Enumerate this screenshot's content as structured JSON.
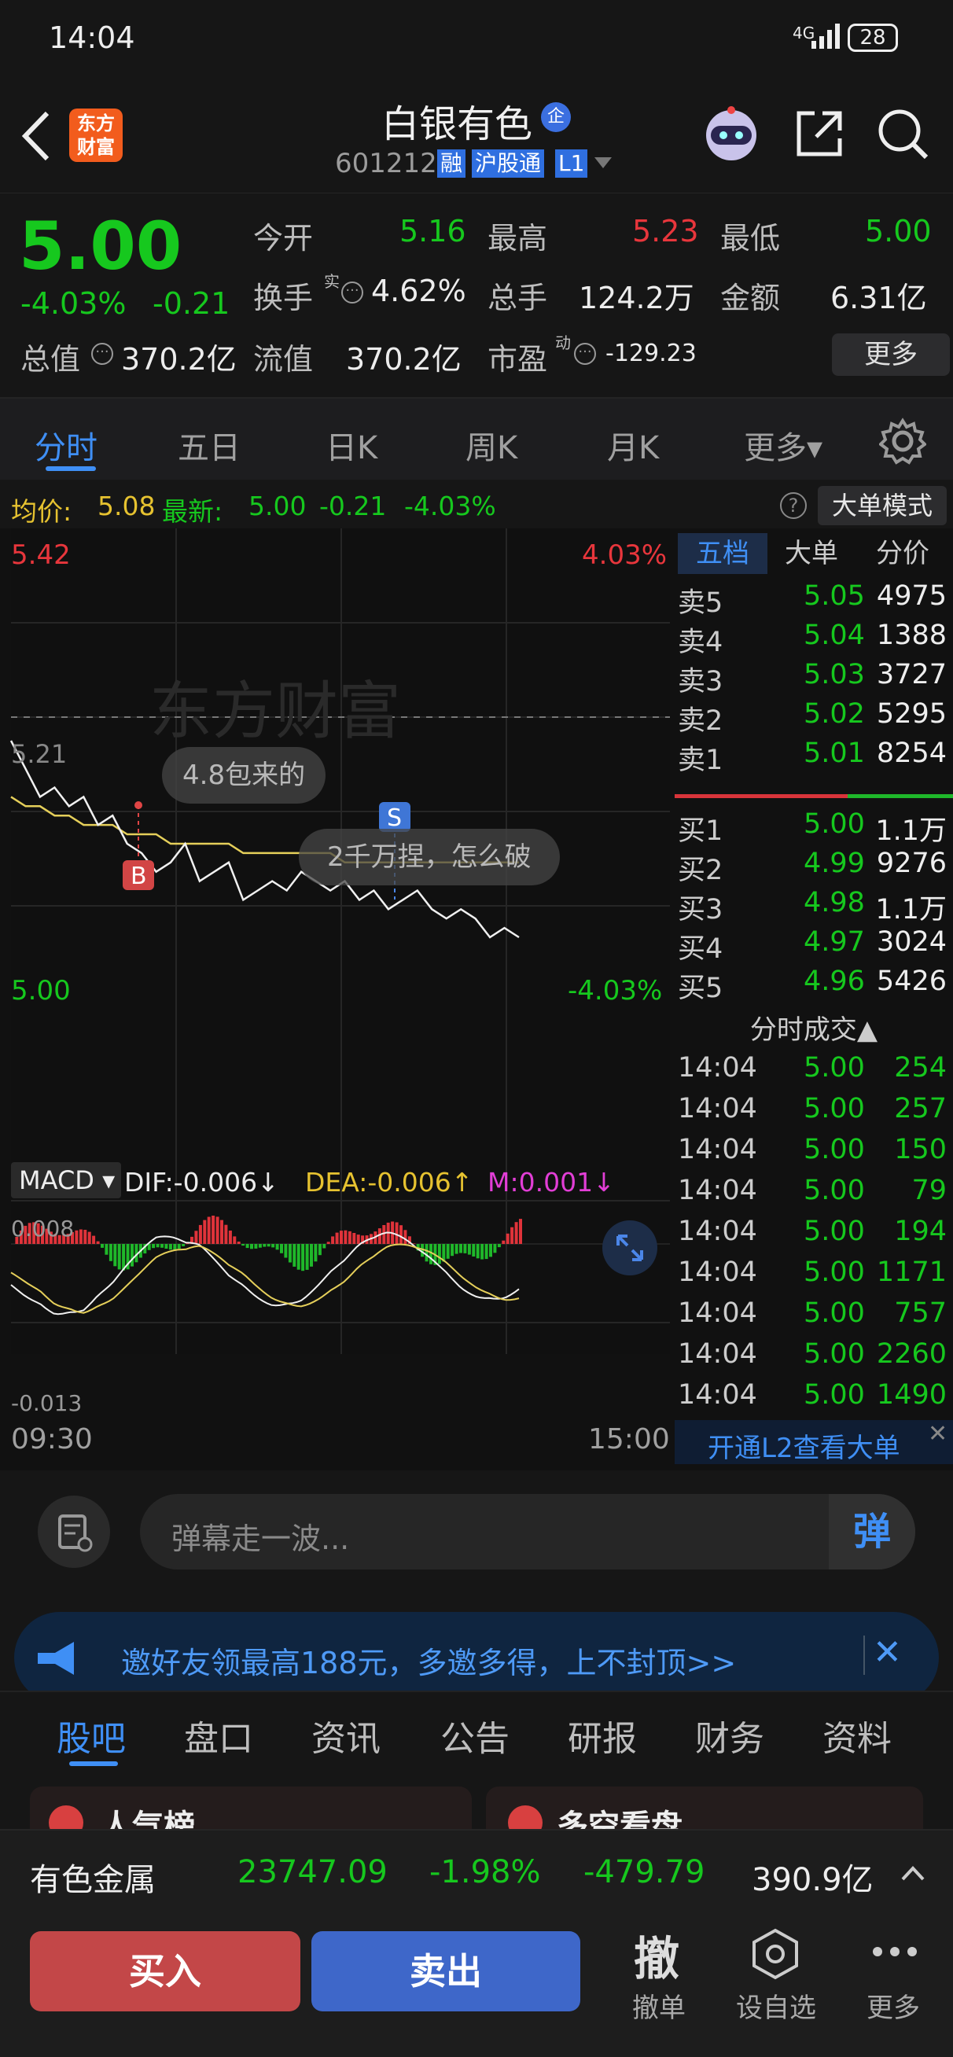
{
  "status": {
    "time": "14:04",
    "network": "4G",
    "battery": "28"
  },
  "header": {
    "logo_line1": "东方",
    "logo_line2": "财富",
    "name": "白银有色",
    "enterprise_badge": "企",
    "code": "601212",
    "tag_rong": "融",
    "tag_hgt": "沪股通",
    "tag_l1": "L1"
  },
  "quote": {
    "price": "5.00",
    "pct": "-4.03%",
    "chg": "-0.21",
    "open_label": "今开",
    "open": "5.16",
    "high_label": "最高",
    "high": "5.23",
    "low_label": "最低",
    "low": "5.00",
    "turnover_label": "换手",
    "turnover_sup": "实",
    "turnover": "4.62%",
    "volume_label": "总手",
    "volume": "124.2万",
    "amount_label": "金额",
    "amount": "6.31亿",
    "mktcap_label": "总值",
    "mktcap": "370.2亿",
    "float_label": "流值",
    "float": "370.2亿",
    "pe_label": "市盈",
    "pe_sup": "动",
    "pe": "-129.23",
    "more_btn": "更多"
  },
  "tabs": [
    "分时",
    "五日",
    "日K",
    "周K",
    "月K",
    "更多▾"
  ],
  "infobar": {
    "avg_label": "均价:",
    "avg": "5.08",
    "latest_label": "最新:",
    "latest": "5.00",
    "chg": "-0.21",
    "pct": "-4.03%",
    "mode_btn": "大单模式"
  },
  "chart": {
    "y_top": "5.42",
    "y_top_pct": "4.03%",
    "y_ref": "5.21",
    "y_bot": "5.00",
    "y_bot_pct": "-4.03%",
    "x_start": "09:30",
    "x_end": "15:00",
    "marker_b": "B",
    "marker_s": "S",
    "danmaku1": "4.8包来的",
    "danmaku2": "2千万捏，怎么破",
    "macd_label": "MACD ▾",
    "dif": "DIF:-0.006↓",
    "dea": "DEA:-0.006↑",
    "m": "M:0.001↓",
    "macd_top": "0.008",
    "macd_bot": "-0.013"
  },
  "chart_data": {
    "type": "line",
    "series": [
      {
        "name": "价格",
        "values": [
          5.21,
          5.18,
          5.15,
          5.16,
          5.14,
          5.15,
          5.12,
          5.13,
          5.1,
          5.09,
          5.07,
          5.08,
          5.1,
          5.06,
          5.07,
          5.08,
          5.04,
          5.05,
          5.06,
          5.05,
          5.07,
          5.06,
          5.05,
          5.06,
          5.04,
          5.05,
          5.03,
          5.04,
          5.05,
          5.03,
          5.02,
          5.03,
          5.02,
          5.0,
          5.01,
          5.0
        ]
      },
      {
        "name": "均价",
        "values": [
          5.15,
          5.14,
          5.14,
          5.13,
          5.13,
          5.12,
          5.12,
          5.12,
          5.11,
          5.11,
          5.11,
          5.1,
          5.1,
          5.1,
          5.1,
          5.1,
          5.09,
          5.09,
          5.09,
          5.09,
          5.09,
          5.09,
          5.09,
          5.08,
          5.08,
          5.08,
          5.08,
          5.08,
          5.08,
          5.08,
          5.08,
          5.08,
          5.08,
          5.08,
          5.08,
          5.08
        ]
      }
    ],
    "ylim": [
      5.0,
      5.42
    ]
  },
  "orderbook": {
    "tabs": [
      "五档",
      "大单",
      "分价"
    ],
    "asks": [
      {
        "label": "卖5",
        "price": "5.05",
        "vol": "4975"
      },
      {
        "label": "卖4",
        "price": "5.04",
        "vol": "1388"
      },
      {
        "label": "卖3",
        "price": "5.03",
        "vol": "3727"
      },
      {
        "label": "卖2",
        "price": "5.02",
        "vol": "5295"
      },
      {
        "label": "卖1",
        "price": "5.01",
        "vol": "8254"
      }
    ],
    "bids": [
      {
        "label": "买1",
        "price": "5.00",
        "vol": "1.1万"
      },
      {
        "label": "买2",
        "price": "4.99",
        "vol": "9276"
      },
      {
        "label": "买3",
        "price": "4.98",
        "vol": "1.1万"
      },
      {
        "label": "买4",
        "price": "4.97",
        "vol": "3024"
      },
      {
        "label": "买5",
        "price": "4.96",
        "vol": "5426"
      }
    ],
    "trades_title": "分时成交▲",
    "trades": [
      {
        "t": "14:04",
        "p": "5.00",
        "v": "254"
      },
      {
        "t": "14:04",
        "p": "5.00",
        "v": "257"
      },
      {
        "t": "14:04",
        "p": "5.00",
        "v": "150"
      },
      {
        "t": "14:04",
        "p": "5.00",
        "v": "79"
      },
      {
        "t": "14:04",
        "p": "5.00",
        "v": "194"
      },
      {
        "t": "14:04",
        "p": "5.00",
        "v": "1171"
      },
      {
        "t": "14:04",
        "p": "5.00",
        "v": "757"
      },
      {
        "t": "14:04",
        "p": "5.00",
        "v": "2260"
      },
      {
        "t": "14:04",
        "p": "5.00",
        "v": "1490"
      }
    ],
    "l2_link": "开通L2查看大单"
  },
  "comment": {
    "placeholder": "弹幕走一波...",
    "send": "弹"
  },
  "banner": {
    "text": "邀好友领最高188元，多邀多得，上不封顶>>"
  },
  "bottom_tabs": [
    "股吧",
    "盘口",
    "资讯",
    "公告",
    "研报",
    "财务",
    "资料"
  ],
  "partial_cards": [
    "人气榜",
    "多空看盘"
  ],
  "sector": {
    "name": "有色金属",
    "value": "23747.09",
    "pct": "-1.98%",
    "chg": "-479.79",
    "amount": "390.9亿"
  },
  "actions": {
    "buy": "买入",
    "sell": "卖出",
    "cancel_icon": "撤",
    "cancel": "撤单",
    "watch": "设自选",
    "more": "更多"
  }
}
